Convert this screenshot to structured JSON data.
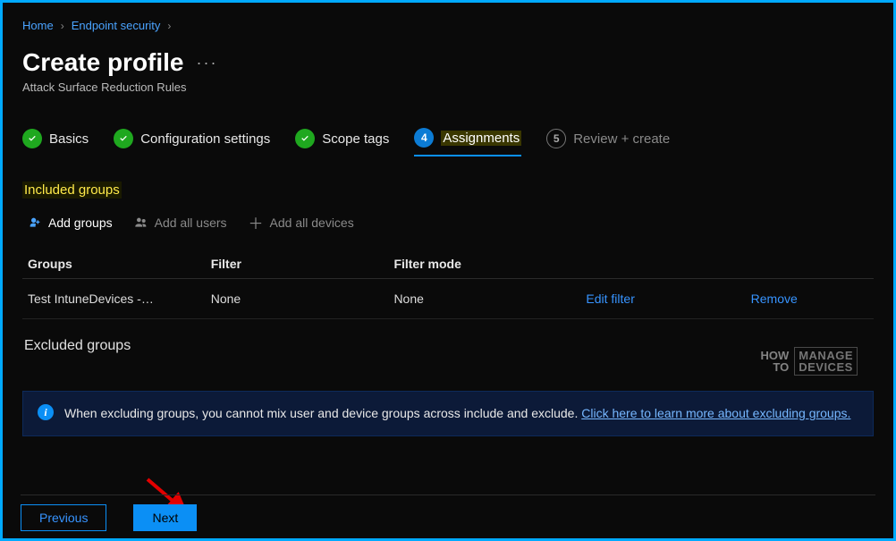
{
  "breadcrumb": {
    "home": "Home",
    "endpoint": "Endpoint security"
  },
  "header": {
    "title": "Create profile",
    "more": "···",
    "subtitle": "Attack Surface Reduction Rules"
  },
  "wizard": {
    "basics": "Basics",
    "config": "Configuration settings",
    "scope": "Scope tags",
    "assignments_num": "4",
    "assignments": "Assignments",
    "review_num": "5",
    "review": "Review + create"
  },
  "sections": {
    "included": "Included groups",
    "excluded": "Excluded groups"
  },
  "actions": {
    "add_groups": "Add groups",
    "add_all_users": "Add all users",
    "add_all_devices": "Add all devices"
  },
  "table": {
    "headers": {
      "groups": "Groups",
      "filter": "Filter",
      "mode": "Filter mode"
    },
    "rows": [
      {
        "group": "Test IntuneDevices -…",
        "filter": "None",
        "mode": "None",
        "edit": "Edit filter",
        "remove": "Remove"
      }
    ]
  },
  "info": {
    "text": "When excluding groups, you cannot mix user and device groups across include and exclude. ",
    "link": "Click here to learn more about excluding groups."
  },
  "footer": {
    "previous": "Previous",
    "next": "Next"
  },
  "watermark": {
    "how": "HOW",
    "to": "TO",
    "manage": "MANAGE",
    "devices": "DEVICES"
  }
}
